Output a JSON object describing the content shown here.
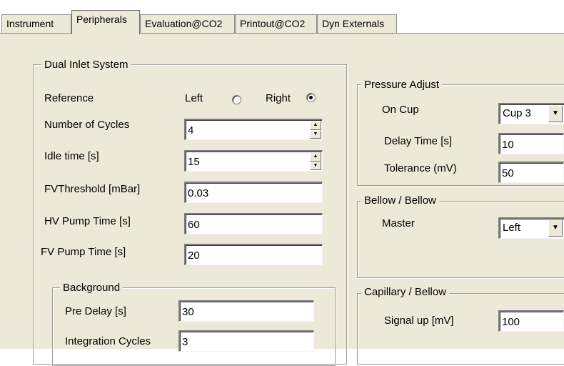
{
  "tabs": [
    {
      "label": "Instrument",
      "active": false
    },
    {
      "label": "Peripherals",
      "active": true
    },
    {
      "label": "Evaluation@CO2",
      "active": false
    },
    {
      "label": "Printout@CO2",
      "active": false
    },
    {
      "label": "Dyn Externals",
      "active": false
    }
  ],
  "dual_inlet": {
    "title": "Dual Inlet System",
    "reference": {
      "label": "Reference",
      "left_label": "Left",
      "right_label": "Right",
      "selected": "Right"
    },
    "number_of_cycles": {
      "label": "Number of Cycles",
      "value": "4"
    },
    "idle_time": {
      "label": "Idle time [s]",
      "value": "15"
    },
    "fv_threshold": {
      "label": "FVThreshold [mBar]",
      "value": "0.03"
    },
    "hv_pump_time": {
      "label": "HV Pump Time [s]",
      "value": "60"
    },
    "fv_pump_time": {
      "label": "FV Pump Time [s]",
      "value": "20"
    },
    "background": {
      "title": "Background",
      "pre_delay": {
        "label": "Pre Delay [s]",
        "value": "30"
      },
      "integration_cycles": {
        "label": "Integration Cycles",
        "value": "3"
      }
    }
  },
  "pressure_adjust": {
    "title": "Pressure Adjust",
    "on_cup": {
      "label": "On Cup",
      "value": "Cup 3"
    },
    "delay_time": {
      "label": "Delay Time [s]",
      "value": "10"
    },
    "tolerance": {
      "label": "Tolerance (mV)",
      "value": "50"
    }
  },
  "bellow_bellow": {
    "title": "Bellow / Bellow",
    "master": {
      "label": "Master",
      "value": "Left"
    }
  },
  "capillary_bellow": {
    "title": "Capillary / Bellow",
    "signal_up": {
      "label": "Signal up [mV]",
      "value": "100"
    }
  }
}
